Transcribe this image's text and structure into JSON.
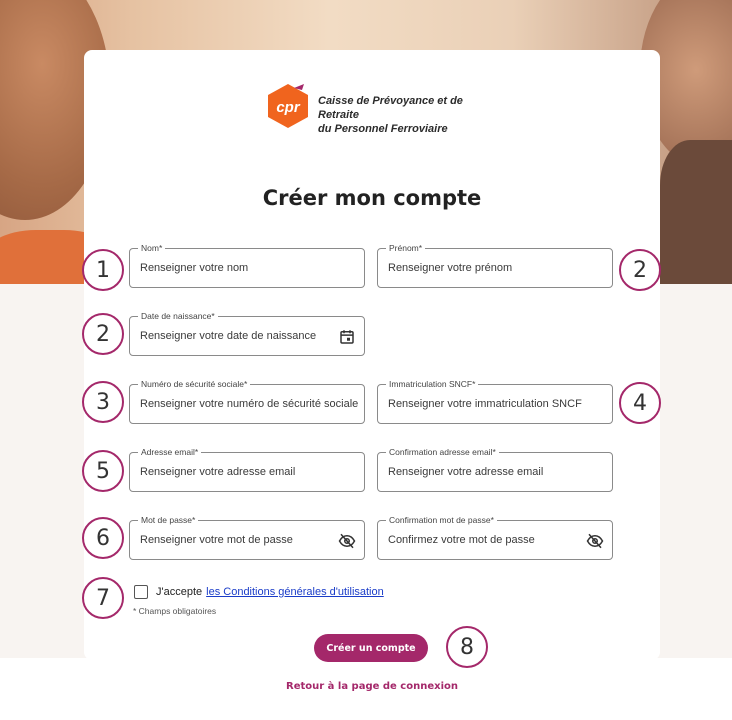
{
  "brand": {
    "logo_mark": "cpr",
    "name_line1": "Caisse de Prévoyance et de Retraite",
    "name_line2": "du Personnel Ferroviaire",
    "primary_color": "#a4286a",
    "logo_color": "#f0641e"
  },
  "form": {
    "title": "Créer mon compte",
    "fields": {
      "nom": {
        "label": "Nom*",
        "placeholder": "Renseigner votre nom"
      },
      "prenom": {
        "label": "Prénom*",
        "placeholder": "Renseigner votre prénom"
      },
      "date_naissance": {
        "label": "Date de naissance*",
        "placeholder": "Renseigner votre date de naissance",
        "icon": "calendar-icon"
      },
      "securite_sociale": {
        "label": "Numéro de sécurité sociale*",
        "placeholder": "Renseigner votre numéro de sécurité sociale"
      },
      "sncf": {
        "label": "Immatriculation SNCF*",
        "placeholder": "Renseigner votre immatriculation SNCF"
      },
      "email": {
        "label": "Adresse email*",
        "placeholder": "Renseigner votre adresse email"
      },
      "email_confirm": {
        "label": "Confirmation adresse email*",
        "placeholder": "Renseigner votre adresse email"
      },
      "password": {
        "label": "Mot de passe*",
        "placeholder": "Renseigner votre mot de passe",
        "icon": "eye-off-icon"
      },
      "password_confirm": {
        "label": "Confirmation mot de passe*",
        "placeholder": "Confirmez votre mot de passe",
        "icon": "eye-off-icon"
      }
    },
    "cgu_prefix": "J'accepte",
    "cgu_link": "les Conditions générales d'utilisation",
    "required_note": "* Champs obligatoires",
    "submit_label": "Créer un compte",
    "back_link": "Retour à la page de connexion"
  },
  "markers": [
    "1",
    "2",
    "2",
    "3",
    "4",
    "5",
    "6",
    "7",
    "8"
  ]
}
